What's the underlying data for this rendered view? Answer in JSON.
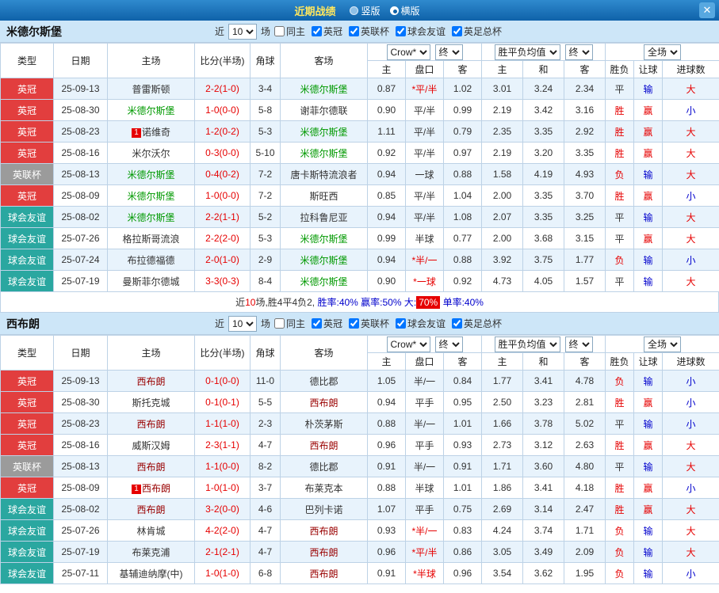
{
  "titlebar": {
    "title": "近期战绩",
    "vertical_label": "竖版",
    "horizontal_label": "横版",
    "selected_layout": "横版",
    "close_glyph": "✕"
  },
  "filters": {
    "near_label": "近",
    "count_value": "10",
    "games_label": "场",
    "same_home_label": "同主",
    "same_home_checked": false,
    "leagues": [
      {
        "label": "英冠",
        "checked": true
      },
      {
        "label": "英联杯",
        "checked": true
      },
      {
        "label": "球会友谊",
        "checked": true
      },
      {
        "label": "英足总杯",
        "checked": true
      }
    ]
  },
  "table": {
    "static_headers": [
      "类型",
      "日期",
      "主场",
      "比分(半场)",
      "角球",
      "客场"
    ],
    "bookmaker_select": "Crow*",
    "final_select": "终",
    "avg_select": "胜平负均值",
    "scope_select": "全场",
    "odds_sub_headers": [
      "主",
      "盘口",
      "客"
    ],
    "avg_sub_headers": [
      "主",
      "和",
      "客"
    ],
    "result_sub_headers": [
      "胜负",
      "让球",
      "进球数"
    ]
  },
  "colors": {
    "type_colors": {
      "英冠": "#e23e3e",
      "英联杯": "#9b9b9b",
      "球会友谊": "#2aa7a0"
    },
    "value_colors": {
      "胜": "#e60000",
      "平": "#333333",
      "负": "#e60000",
      "赢": "#e60000",
      "输": "#0000cc",
      "大": "#e60000",
      "小": "#0000cc"
    },
    "score_color": "#e60000",
    "starred_handicap_color": "#e60000"
  },
  "sections": [
    {
      "team": "米德尔斯堡",
      "team_color": "#009900",
      "rows": [
        {
          "type": "英冠",
          "date": "25-09-13",
          "rank": "",
          "home": "普雷斯顿",
          "home_self": false,
          "score": "2-2(1-0)",
          "corner": "3-4",
          "away": "米德尔斯堡",
          "away_self": true,
          "home_odds": "0.87",
          "handicap": "*平/半",
          "away_odds": "1.02",
          "avg_home": "3.01",
          "avg_draw": "3.24",
          "avg_away": "2.34",
          "result": "平",
          "handicap_result": "输",
          "goals_result": "大"
        },
        {
          "type": "英冠",
          "date": "25-08-30",
          "rank": "",
          "home": "米德尔斯堡",
          "home_self": true,
          "score": "1-0(0-0)",
          "corner": "5-8",
          "away": "谢菲尔德联",
          "away_self": false,
          "home_odds": "0.90",
          "handicap": "平/半",
          "away_odds": "0.99",
          "avg_home": "2.19",
          "avg_draw": "3.42",
          "avg_away": "3.16",
          "result": "胜",
          "handicap_result": "赢",
          "goals_result": "小"
        },
        {
          "type": "英冠",
          "date": "25-08-23",
          "rank": "1",
          "home": "诺维奇",
          "home_self": false,
          "score": "1-2(0-2)",
          "corner": "5-3",
          "away": "米德尔斯堡",
          "away_self": true,
          "home_odds": "1.11",
          "handicap": "平/半",
          "away_odds": "0.79",
          "avg_home": "2.35",
          "avg_draw": "3.35",
          "avg_away": "2.92",
          "result": "胜",
          "handicap_result": "赢",
          "goals_result": "大"
        },
        {
          "type": "英冠",
          "date": "25-08-16",
          "rank": "",
          "home": "米尔沃尔",
          "home_self": false,
          "score": "0-3(0-0)",
          "corner": "5-10",
          "away": "米德尔斯堡",
          "away_self": true,
          "home_odds": "0.92",
          "handicap": "平/半",
          "away_odds": "0.97",
          "avg_home": "2.19",
          "avg_draw": "3.20",
          "avg_away": "3.35",
          "result": "胜",
          "handicap_result": "赢",
          "goals_result": "大"
        },
        {
          "type": "英联杯",
          "date": "25-08-13",
          "rank": "",
          "home": "米德尔斯堡",
          "home_self": true,
          "score": "0-4(0-2)",
          "corner": "7-2",
          "away": "唐卡斯特流浪者",
          "away_self": false,
          "home_odds": "0.94",
          "handicap": "一球",
          "away_odds": "0.88",
          "avg_home": "1.58",
          "avg_draw": "4.19",
          "avg_away": "4.93",
          "result": "负",
          "handicap_result": "输",
          "goals_result": "大"
        },
        {
          "type": "英冠",
          "date": "25-08-09",
          "rank": "",
          "home": "米德尔斯堡",
          "home_self": true,
          "score": "1-0(0-0)",
          "corner": "7-2",
          "away": "斯旺西",
          "away_self": false,
          "home_odds": "0.85",
          "handicap": "平/半",
          "away_odds": "1.04",
          "avg_home": "2.00",
          "avg_draw": "3.35",
          "avg_away": "3.70",
          "result": "胜",
          "handicap_result": "赢",
          "goals_result": "小"
        },
        {
          "type": "球会友谊",
          "date": "25-08-02",
          "rank": "",
          "home": "米德尔斯堡",
          "home_self": true,
          "score": "2-2(1-1)",
          "corner": "5-2",
          "away": "拉科鲁尼亚",
          "away_self": false,
          "home_odds": "0.94",
          "handicap": "平/半",
          "away_odds": "1.08",
          "avg_home": "2.07",
          "avg_draw": "3.35",
          "avg_away": "3.25",
          "result": "平",
          "handicap_result": "输",
          "goals_result": "大"
        },
        {
          "type": "球会友谊",
          "date": "25-07-26",
          "rank": "",
          "home": "格拉斯哥流浪",
          "home_self": false,
          "score": "2-2(2-0)",
          "corner": "5-3",
          "away": "米德尔斯堡",
          "away_self": true,
          "home_odds": "0.99",
          "handicap": "半球",
          "away_odds": "0.77",
          "avg_home": "2.00",
          "avg_draw": "3.68",
          "avg_away": "3.15",
          "result": "平",
          "handicap_result": "赢",
          "goals_result": "大"
        },
        {
          "type": "球会友谊",
          "date": "25-07-24",
          "rank": "",
          "home": "布拉德福德",
          "home_self": false,
          "score": "2-0(1-0)",
          "corner": "2-9",
          "away": "米德尔斯堡",
          "away_self": true,
          "home_odds": "0.94",
          "handicap": "*半/一",
          "away_odds": "0.88",
          "avg_home": "3.92",
          "avg_draw": "3.75",
          "avg_away": "1.77",
          "result": "负",
          "handicap_result": "输",
          "goals_result": "小"
        },
        {
          "type": "球会友谊",
          "date": "25-07-19",
          "rank": "",
          "home": "曼斯菲尔德城",
          "home_self": false,
          "score": "3-3(0-3)",
          "corner": "8-4",
          "away": "米德尔斯堡",
          "away_self": true,
          "home_odds": "0.90",
          "handicap": "*一球",
          "away_odds": "0.92",
          "avg_home": "4.73",
          "avg_draw": "4.05",
          "avg_away": "1.57",
          "result": "平",
          "handicap_result": "输",
          "goals_result": "大"
        }
      ],
      "summary_parts": [
        {
          "text": "近",
          "color": "#333333"
        },
        {
          "text": "10",
          "color": "#e60000"
        },
        {
          "text": "场,胜4平4负2, ",
          "color": "#333333"
        },
        {
          "text": "胜率:40% ",
          "color": "#0000cc"
        },
        {
          "text": "赢率:50% ",
          "color": "#0000cc"
        },
        {
          "text": "大:",
          "color": "#0000cc"
        },
        {
          "text": "70%",
          "color": "#ffffff",
          "bg": "#e60000"
        },
        {
          "text": " 单率:40%",
          "color": "#0000cc"
        }
      ]
    },
    {
      "team": "西布朗",
      "team_color": "#990000",
      "rows": [
        {
          "type": "英冠",
          "date": "25-09-13",
          "rank": "",
          "home": "西布朗",
          "home_self": true,
          "score": "0-1(0-0)",
          "corner": "11-0",
          "away": "德比郡",
          "away_self": false,
          "home_odds": "1.05",
          "handicap": "半/一",
          "away_odds": "0.84",
          "avg_home": "1.77",
          "avg_draw": "3.41",
          "avg_away": "4.78",
          "result": "负",
          "handicap_result": "输",
          "goals_result": "小"
        },
        {
          "type": "英冠",
          "date": "25-08-30",
          "rank": "",
          "home": "斯托克城",
          "home_self": false,
          "score": "0-1(0-1)",
          "corner": "5-5",
          "away": "西布朗",
          "away_self": true,
          "home_odds": "0.94",
          "handicap": "平手",
          "away_odds": "0.95",
          "avg_home": "2.50",
          "avg_draw": "3.23",
          "avg_away": "2.81",
          "result": "胜",
          "handicap_result": "赢",
          "goals_result": "小"
        },
        {
          "type": "英冠",
          "date": "25-08-23",
          "rank": "",
          "home": "西布朗",
          "home_self": true,
          "score": "1-1(1-0)",
          "corner": "2-3",
          "away": "朴茨茅斯",
          "away_self": false,
          "home_odds": "0.88",
          "handicap": "半/一",
          "away_odds": "1.01",
          "avg_home": "1.66",
          "avg_draw": "3.78",
          "avg_away": "5.02",
          "result": "平",
          "handicap_result": "输",
          "goals_result": "小"
        },
        {
          "type": "英冠",
          "date": "25-08-16",
          "rank": "",
          "home": "威斯汉姆",
          "home_self": false,
          "score": "2-3(1-1)",
          "corner": "4-7",
          "away": "西布朗",
          "away_self": true,
          "home_odds": "0.96",
          "handicap": "平手",
          "away_odds": "0.93",
          "avg_home": "2.73",
          "avg_draw": "3.12",
          "avg_away": "2.63",
          "result": "胜",
          "handicap_result": "赢",
          "goals_result": "大"
        },
        {
          "type": "英联杯",
          "date": "25-08-13",
          "rank": "",
          "home": "西布朗",
          "home_self": true,
          "score": "1-1(0-0)",
          "corner": "8-2",
          "away": "德比郡",
          "away_self": false,
          "home_odds": "0.91",
          "handicap": "半/一",
          "away_odds": "0.91",
          "avg_home": "1.71",
          "avg_draw": "3.60",
          "avg_away": "4.80",
          "result": "平",
          "handicap_result": "输",
          "goals_result": "大"
        },
        {
          "type": "英冠",
          "date": "25-08-09",
          "rank": "1",
          "home": "西布朗",
          "home_self": true,
          "score": "1-0(1-0)",
          "corner": "3-7",
          "away": "布莱克本",
          "away_self": false,
          "home_odds": "0.88",
          "handicap": "半球",
          "away_odds": "1.01",
          "avg_home": "1.86",
          "avg_draw": "3.41",
          "avg_away": "4.18",
          "result": "胜",
          "handicap_result": "赢",
          "goals_result": "小"
        },
        {
          "type": "球会友谊",
          "date": "25-08-02",
          "rank": "",
          "home": "西布朗",
          "home_self": true,
          "score": "3-2(0-0)",
          "corner": "4-6",
          "away": "巴列卡诺",
          "away_self": false,
          "home_odds": "1.07",
          "handicap": "平手",
          "away_odds": "0.75",
          "avg_home": "2.69",
          "avg_draw": "3.14",
          "avg_away": "2.47",
          "result": "胜",
          "handicap_result": "赢",
          "goals_result": "大"
        },
        {
          "type": "球会友谊",
          "date": "25-07-26",
          "rank": "",
          "home": "林肯城",
          "home_self": false,
          "score": "4-2(2-0)",
          "corner": "4-7",
          "away": "西布朗",
          "away_self": true,
          "home_odds": "0.93",
          "handicap": "*半/一",
          "away_odds": "0.83",
          "avg_home": "4.24",
          "avg_draw": "3.74",
          "avg_away": "1.71",
          "result": "负",
          "handicap_result": "输",
          "goals_result": "大"
        },
        {
          "type": "球会友谊",
          "date": "25-07-19",
          "rank": "",
          "home": "布莱克浦",
          "home_self": false,
          "score": "2-1(2-1)",
          "corner": "4-7",
          "away": "西布朗",
          "away_self": true,
          "home_odds": "0.96",
          "handicap": "*平/半",
          "away_odds": "0.86",
          "avg_home": "3.05",
          "avg_draw": "3.49",
          "avg_away": "2.09",
          "result": "负",
          "handicap_result": "输",
          "goals_result": "大"
        },
        {
          "type": "球会友谊",
          "date": "25-07-11",
          "rank": "",
          "home": "基辅迪纳摩(中)",
          "home_self": false,
          "score": "1-0(1-0)",
          "corner": "6-8",
          "away": "西布朗",
          "away_self": true,
          "home_odds": "0.91",
          "handicap": "*半球",
          "away_odds": "0.96",
          "avg_home": "3.54",
          "avg_draw": "3.62",
          "avg_away": "1.95",
          "result": "负",
          "handicap_result": "输",
          "goals_result": "小"
        }
      ]
    }
  ]
}
